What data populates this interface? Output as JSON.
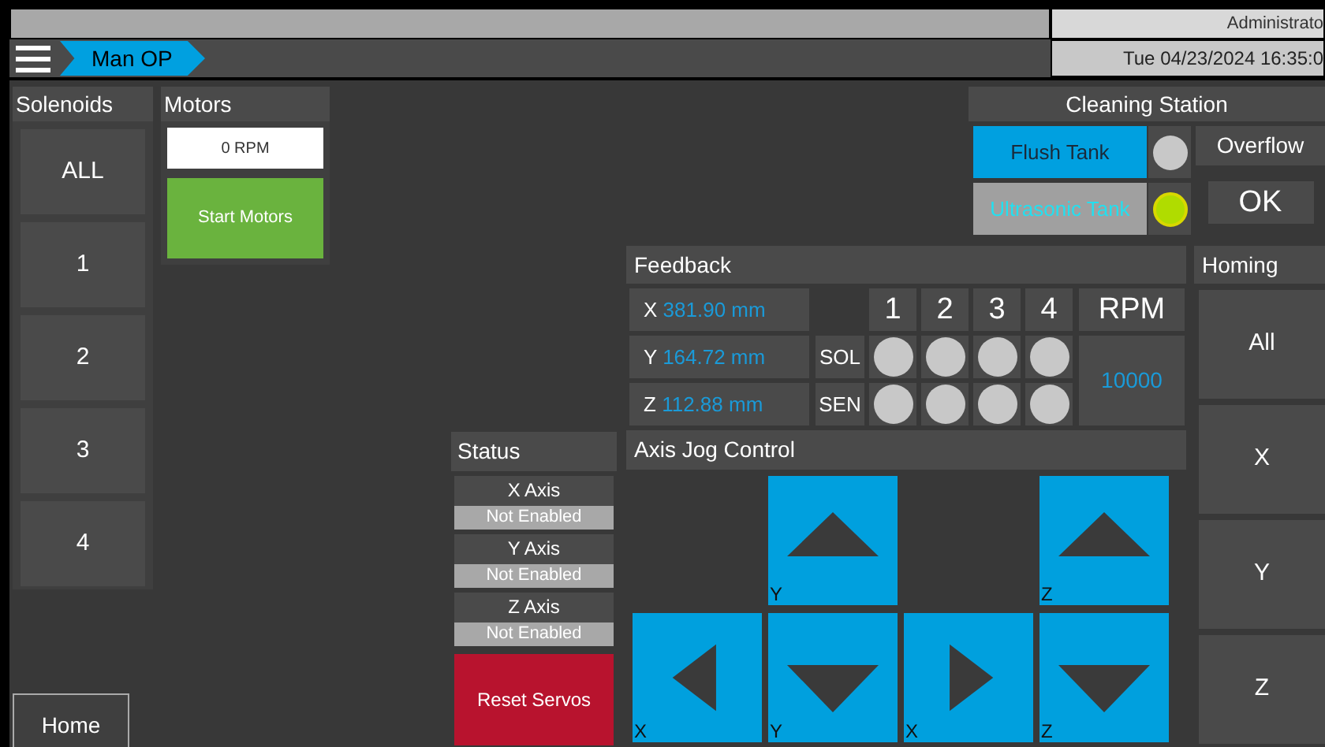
{
  "header": {
    "user": "Administrato",
    "datetime": "Tue 04/23/2024 16:35:0",
    "breadcrumb": "Man OP"
  },
  "solenoids": {
    "title": "Solenoids",
    "buttons": [
      "ALL",
      "1",
      "2",
      "3",
      "4"
    ]
  },
  "motors": {
    "title": "Motors",
    "rpm": "0 RPM",
    "start": "Start Motors"
  },
  "home": "Home",
  "cleaning_station": {
    "title": "Cleaning Station",
    "tanks": [
      {
        "label": "Flush Tank",
        "selected": true,
        "lamp_on": false
      },
      {
        "label": "Ultrasonic Tank",
        "selected": false,
        "lamp_on": true
      }
    ],
    "overflow": "Overflow",
    "overflow_state": "OK"
  },
  "feedback": {
    "title": "Feedback",
    "positions": [
      {
        "axis": "X",
        "value": "381.90 mm"
      },
      {
        "axis": "Y",
        "value": "164.72 mm"
      },
      {
        "axis": "Z",
        "value": "112.88 mm"
      }
    ],
    "columns": [
      "1",
      "2",
      "3",
      "4"
    ],
    "rpm_label": "RPM",
    "rpm": "10000",
    "rows": [
      {
        "label": "SOL",
        "lamps": [
          false,
          false,
          false,
          false
        ]
      },
      {
        "label": "SEN",
        "lamps": [
          false,
          false,
          false,
          false
        ]
      }
    ]
  },
  "homing": {
    "title": "Homing",
    "buttons": [
      "All",
      "X",
      "Y",
      "Z"
    ]
  },
  "status": {
    "title": "Status",
    "axes": [
      {
        "name": "X Axis",
        "state": "Not Enabled"
      },
      {
        "name": "Y Axis",
        "state": "Not Enabled"
      },
      {
        "name": "Z Axis",
        "state": "Not Enabled"
      }
    ],
    "reset": "Reset Servos"
  },
  "jog": {
    "title": "Axis Jog Control",
    "buttons": [
      {
        "kind": "up",
        "label": "Y"
      },
      {
        "kind": "up",
        "label": "Z"
      },
      {
        "kind": "left",
        "label": "X"
      },
      {
        "kind": "down",
        "label": "Y"
      },
      {
        "kind": "right",
        "label": "X"
      },
      {
        "kind": "down",
        "label": "Z"
      }
    ]
  }
}
